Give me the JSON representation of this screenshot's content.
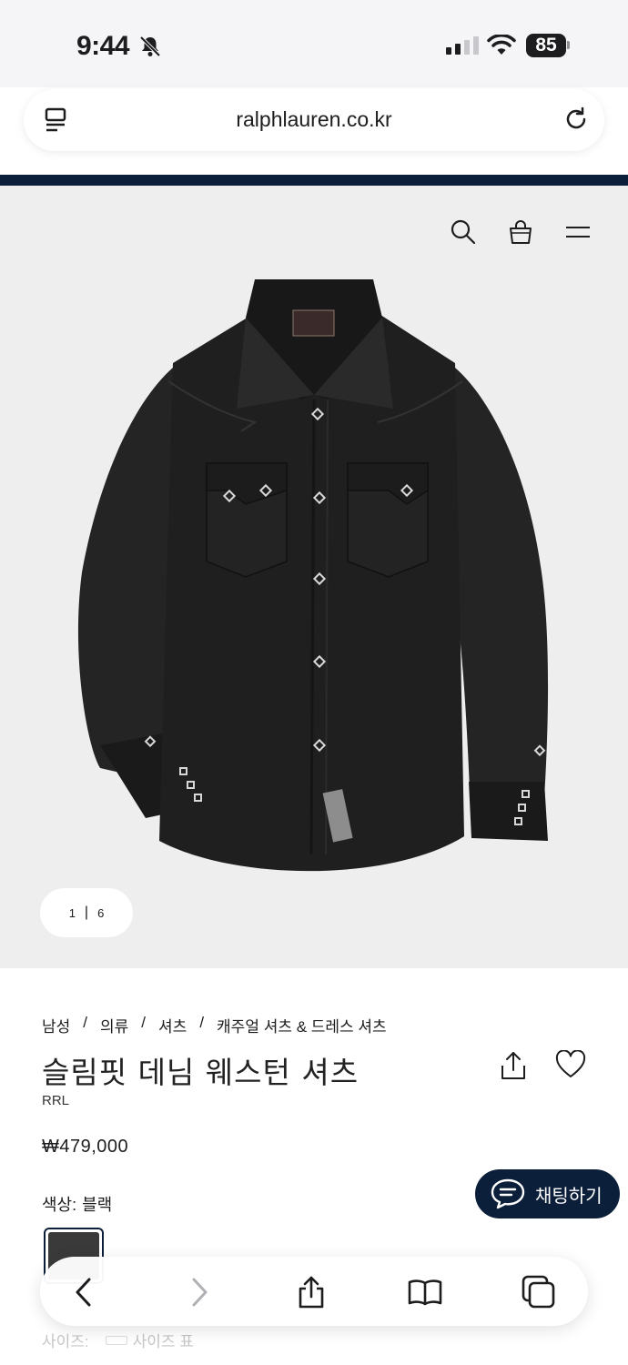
{
  "status": {
    "time": "9:44",
    "battery": "85"
  },
  "browser": {
    "url": "ralphlauren.co.kr"
  },
  "gallery": {
    "current": "1",
    "separator": "|",
    "total": "6"
  },
  "breadcrumb": [
    "남성",
    "/",
    "의류",
    "/",
    "셔츠",
    "/",
    "캐주얼 셔츠 & 드레스 셔츠"
  ],
  "product": {
    "title": "슬림핏 데님 웨스턴 셔츠",
    "brand": "RRL",
    "price": "₩479,000",
    "color_label": "색상:",
    "color_value": "블랙",
    "size_label": "사이즈:",
    "size_chart": "사이즈 표"
  },
  "chat": {
    "label": "채팅하기"
  },
  "colors": {
    "navy": "#0b1f3a",
    "hero_bg": "#efeeee",
    "shirt": "#1f1f1f"
  },
  "icons": [
    "bell-slash-icon",
    "signal-icon",
    "wifi-icon",
    "reader-icon",
    "reload-icon",
    "search-icon",
    "bag-icon",
    "menu-icon",
    "share-icon",
    "heart-icon",
    "chat-icon",
    "back-icon",
    "forward-icon",
    "bookmarks-icon",
    "tabs-icon"
  ]
}
